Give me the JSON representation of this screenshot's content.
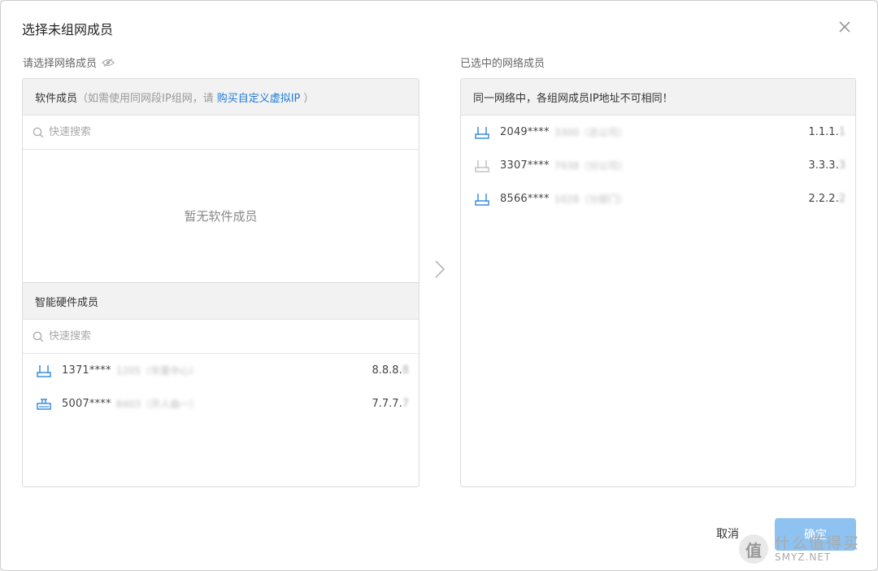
{
  "dialog": {
    "title": "选择未组网成员"
  },
  "left": {
    "label": "请选择网络成员",
    "software": {
      "heading": "软件成员",
      "hint_prefix": "（如需使用同网段IP组网，请",
      "hint_link": "购买自定义虚拟IP",
      "hint_suffix": "）",
      "search_placeholder": "快速搜索",
      "empty_text": "暂无软件成员"
    },
    "hardware": {
      "heading": "智能硬件成员",
      "search_placeholder": "快速搜索",
      "items": [
        {
          "id": "1371****",
          "blurred": "1205（华夏中心）",
          "ip": "8.8.8.",
          "ip_blur": "8",
          "icon": "router-icon"
        },
        {
          "id": "5007****",
          "blurred": "8403（开人曲一）",
          "ip": "7.7.7.",
          "ip_blur": "7",
          "icon": "device-box-icon"
        }
      ]
    }
  },
  "right": {
    "label": "已选中的网络成员",
    "notice": "同一网络中，各组网成员IP地址不可相同！",
    "items": [
      {
        "id": "2049****",
        "blurred": "3300（总公司）",
        "ip": "1.1.1.",
        "ip_blur": "1",
        "icon": "router-icon",
        "color": "#3b8ee0"
      },
      {
        "id": "3307****",
        "blurred": "7938（分公司）",
        "ip": "3.3.3.",
        "ip_blur": "3",
        "icon": "router-icon",
        "color": "#c4c4c4"
      },
      {
        "id": "8566****",
        "blurred": "1028（分部门）",
        "ip": "2.2.2.",
        "ip_blur": "2",
        "icon": "router-icon",
        "color": "#3b8ee0"
      }
    ]
  },
  "footer": {
    "cancel_label": "取消",
    "ok_label": "确定"
  },
  "watermark": {
    "badge": "值",
    "cn": "什么值得买",
    "en": "SMYZ.NET"
  },
  "colors": {
    "accent": "#1f7ad6",
    "ok_button": "#8ec2f0",
    "device_blue": "#3b8ee0"
  }
}
